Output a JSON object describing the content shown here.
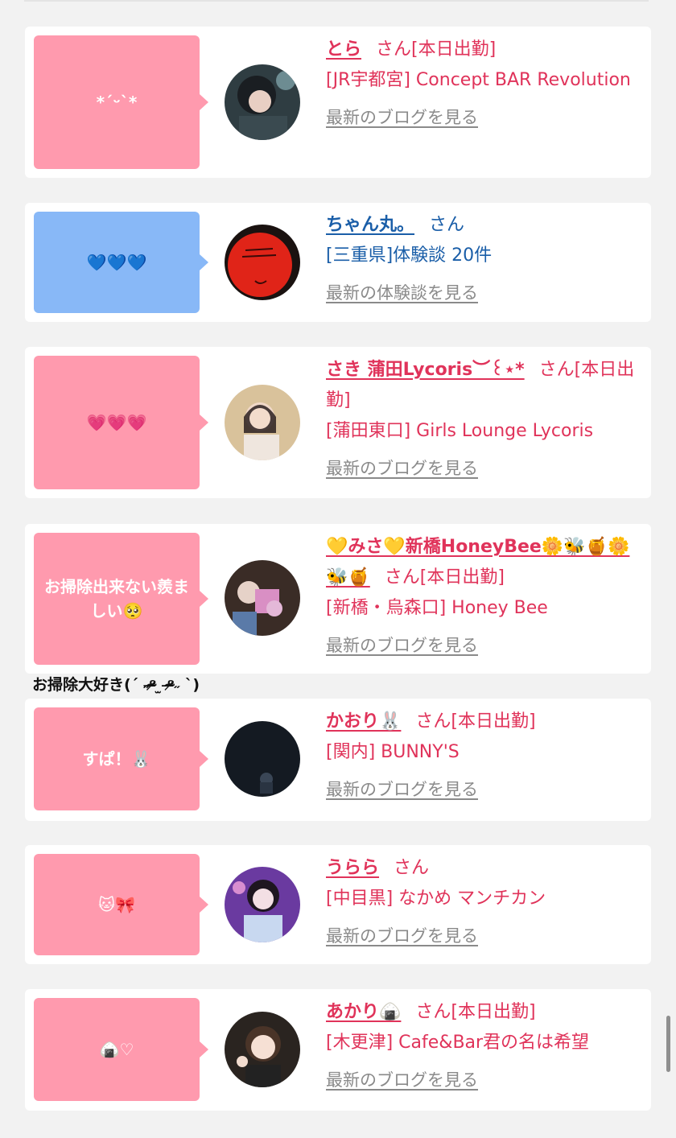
{
  "floating_text": "お掃除大好き(ˊ ˶ᵒ̴̶̷ ̫ ᵒ̴̶̷˶ ˋ)",
  "cards": [
    {
      "bubble": "*ˊᵕˋ*",
      "bubble_color": "pink",
      "color": "#e0335a",
      "name": "とら",
      "suffix": "さん[本日出勤]",
      "shop": "[JR宇都宮] Concept BAR Revolution",
      "link": "最新のブログを見る"
    },
    {
      "bubble": "💙💙💙",
      "bubble_color": "blue",
      "color": "#1a5ea8",
      "name": "ちゃん丸。",
      "suffix": "さん",
      "shop": "[三重県]体験談 20件",
      "link": "最新の体験談を見る"
    },
    {
      "bubble": "💗💗💗",
      "bubble_color": "pink",
      "color": "#e0335a",
      "name": "さき 蒲田Lycoris︶꒰⋆*",
      "suffix": "さん[本日出勤]",
      "shop": "[蒲田東口] Girls Lounge Lycoris",
      "link": "最新のブログを見る"
    },
    {
      "bubble": "お掃除出来ない羨ましい🥺",
      "bubble_color": "pink",
      "color": "#e0335a",
      "name": "💛みさ💛新橋HoneyBee🌼🐝🍯🌼🐝🍯",
      "suffix": "さん[本日出勤]",
      "shop": "[新橋・烏森口] Honey Bee",
      "link": "最新のブログを見る"
    },
    {
      "bubble": "すぱ！🐰",
      "bubble_color": "pink",
      "color": "#e0335a",
      "name": "かおり🐰",
      "suffix": "さん[本日出勤]",
      "shop": "[関内] BUNNY'S",
      "link": "最新のブログを見る"
    },
    {
      "bubble": "🐱🎀",
      "bubble_color": "pink",
      "color": "#e0335a",
      "name": "うらら",
      "suffix": "さん",
      "shop": "[中目黒] なかめ マンチカン",
      "link": "最新のブログを見る"
    },
    {
      "bubble": "🍙♡",
      "bubble_color": "pink",
      "color": "#e0335a",
      "name": "あかり🍙",
      "suffix": "さん[本日出勤]",
      "shop": "[木更津] Cafe&Bar君の名は希望",
      "link": "最新のブログを見る"
    }
  ]
}
